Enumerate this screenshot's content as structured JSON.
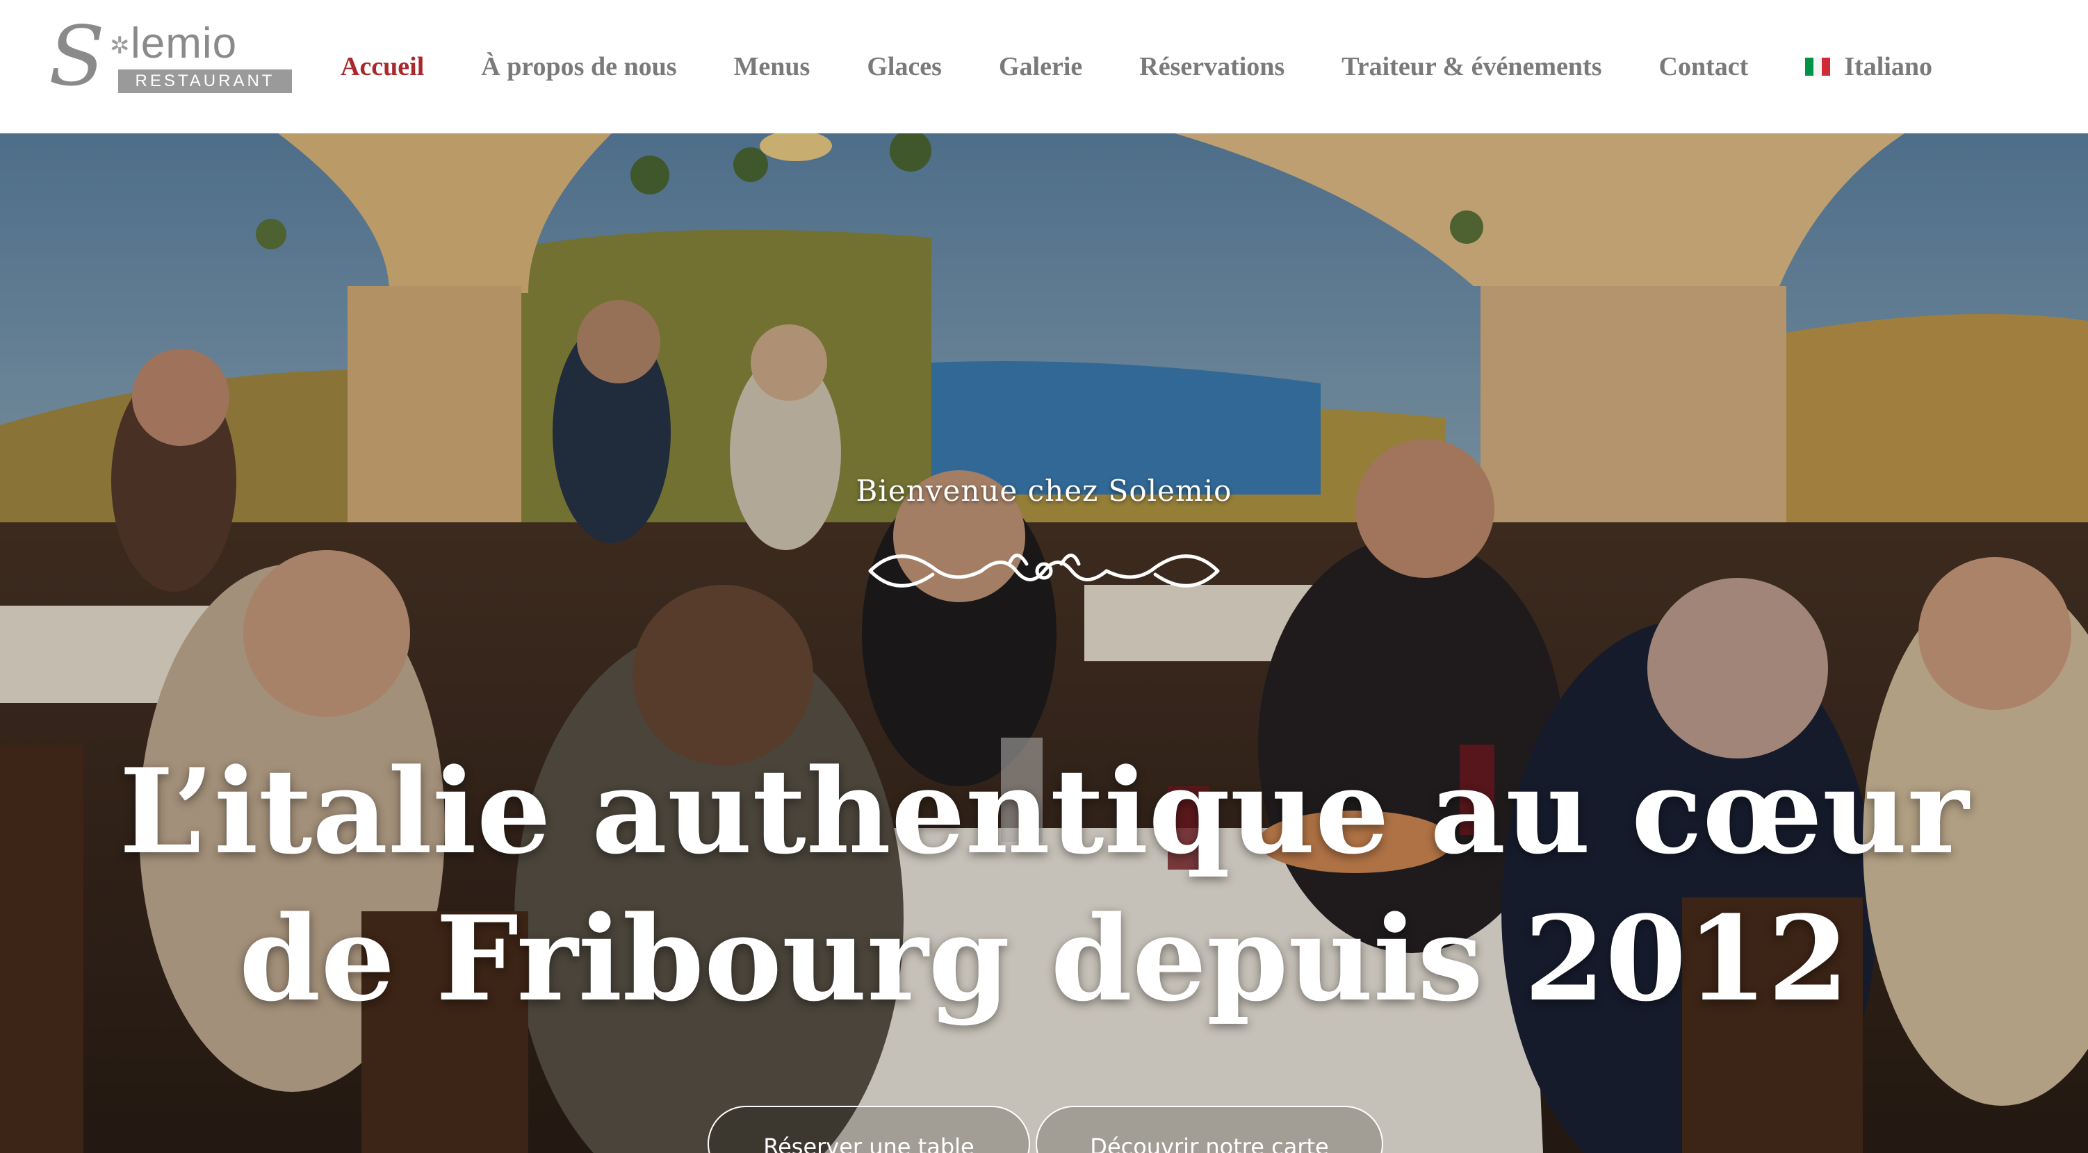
{
  "logo": {
    "letter": "S",
    "word": "lemio",
    "subtitle": "RESTAURANT"
  },
  "nav": {
    "items": [
      {
        "label": "Accueil",
        "active": true
      },
      {
        "label": "À propos de nous"
      },
      {
        "label": "Menus"
      },
      {
        "label": "Glaces"
      },
      {
        "label": "Galerie"
      },
      {
        "label": "Réservations"
      },
      {
        "label": "Traiteur & événements"
      },
      {
        "label": "Contact"
      }
    ],
    "language": {
      "label": "Italiano",
      "flag_icon": "italy-flag-icon"
    }
  },
  "hero": {
    "kicker": "Bienvenue chez Solemio",
    "title_line1": "L’italie authentique au cœur",
    "title_line2": "de Fribourg depuis 2012",
    "buttons": {
      "reserve": "Réserver une table",
      "menu": "Découvrir notre carte"
    }
  },
  "colors": {
    "accent": "#a8282c",
    "nav_text": "#7a7a7a",
    "logo_gray": "#8a8a8a",
    "flag_green": "#009246",
    "flag_white": "#ffffff",
    "flag_red": "#ce2b37"
  }
}
